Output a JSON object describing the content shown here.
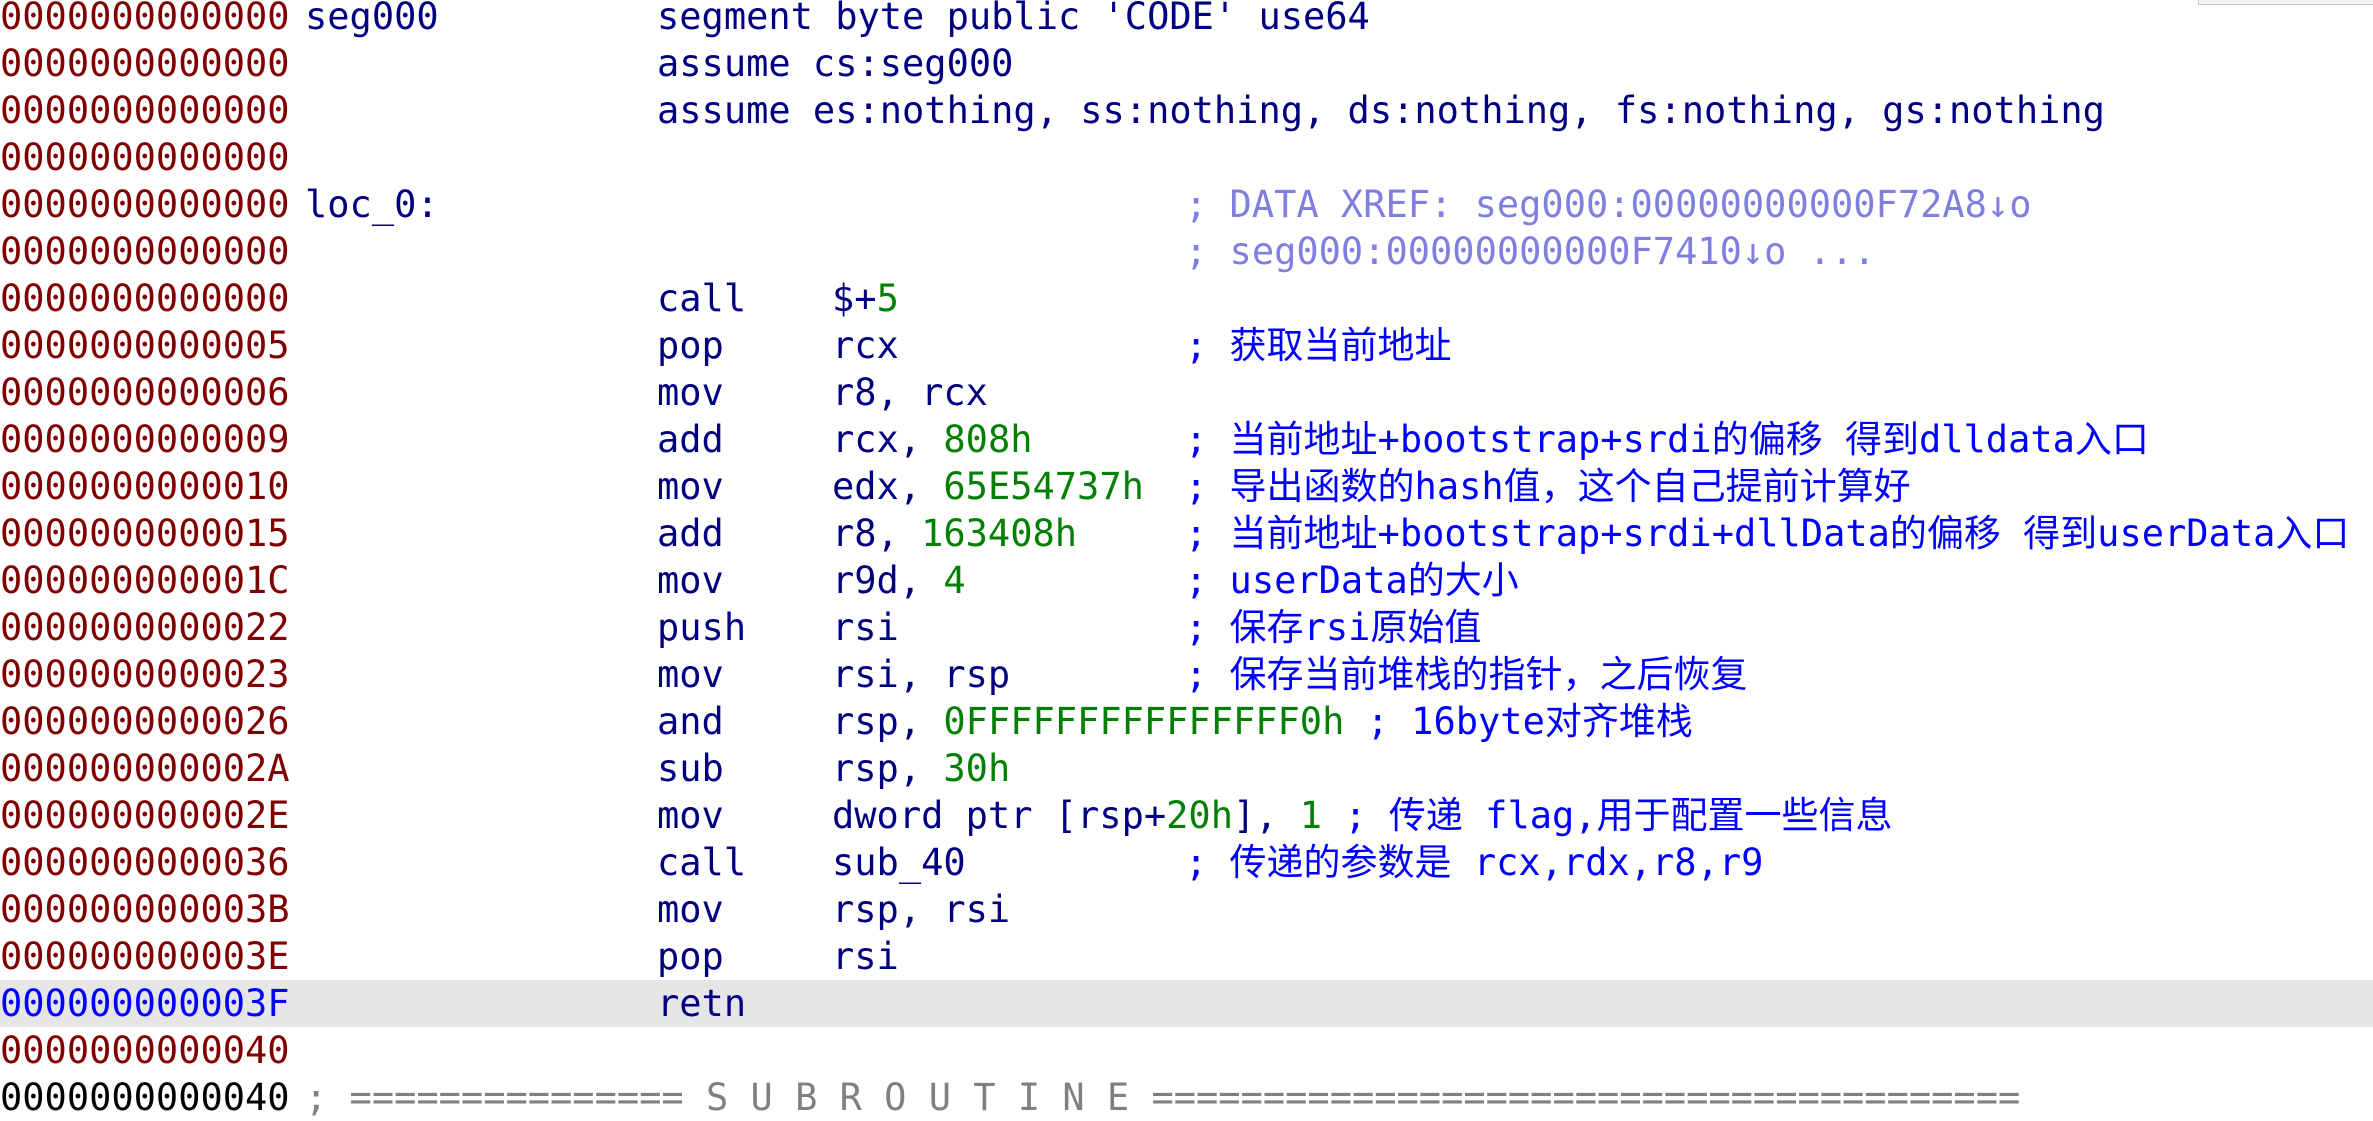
{
  "lines": [
    {
      "addr": "0000000000000",
      "label": "seg000",
      "mnem": "segment byte public 'CODE' use64"
    },
    {
      "addr": "0000000000000",
      "mnem": "assume cs:seg000"
    },
    {
      "addr": "0000000000000",
      "mnem": "assume es:nothing, ss:nothing, ds:nothing, fs:nothing, gs:nothing"
    },
    {
      "addr": "0000000000000"
    },
    {
      "addr": "0000000000000",
      "label": "loc_0:",
      "xref": "; DATA XREF: seg000:00000000000F72A8↓o"
    },
    {
      "addr": "0000000000000",
      "xref": "; seg000:00000000000F7410↓o ..."
    },
    {
      "addr": "0000000000000",
      "mnem": "call",
      "op": "$+",
      "op_num": "5"
    },
    {
      "addr": "0000000000005",
      "mnem": "pop",
      "op": "rcx",
      "comment": "; 获取当前地址"
    },
    {
      "addr": "0000000000006",
      "mnem": "mov",
      "op": "r8, rcx"
    },
    {
      "addr": "0000000000009",
      "mnem": "add",
      "op": "rcx, ",
      "op_num": "808h",
      "comment": "; 当前地址+bootstrap+srdi的偏移 得到dlldata入口"
    },
    {
      "addr": "0000000000010",
      "mnem": "mov",
      "op": "edx, ",
      "op_num": "65E54737h",
      "comment": "; 导出函数的hash值，这个自己提前计算好"
    },
    {
      "addr": "0000000000015",
      "mnem": "add",
      "op": "r8, ",
      "op_num": "163408h",
      "comment": "; 当前地址+bootstrap+srdi+dllData的偏移 得到userData入口"
    },
    {
      "addr": "000000000001C",
      "mnem": "mov",
      "op": "r9d, ",
      "op_num": "4",
      "comment": "; userData的大小"
    },
    {
      "addr": "0000000000022",
      "mnem": "push",
      "op": "rsi",
      "comment": "; 保存rsi原始值"
    },
    {
      "addr": "0000000000023",
      "mnem": "mov",
      "op": "rsi, rsp",
      "comment": "; 保存当前堆栈的指针，之后恢复"
    },
    {
      "addr": "0000000000026",
      "mnem": "and",
      "op": "rsp, ",
      "op_num": "0FFFFFFFFFFFFFFF0h",
      "inline_comment": " ; 16byte对齐堆栈"
    },
    {
      "addr": "000000000002A",
      "mnem": "sub",
      "op": "rsp, ",
      "op_num": "30h"
    },
    {
      "addr": "000000000002E",
      "mnem": "mov",
      "op": "dword ptr [rsp+",
      "op_num": "20h",
      "op_tail": "], ",
      "op_num2": "1",
      "inline_comment": " ; 传递 flag,用于配置一些信息"
    },
    {
      "addr": "0000000000036",
      "mnem": "call",
      "op": "sub_40",
      "comment": "; 传递的参数是 rcx,rdx,r8,r9"
    },
    {
      "addr": "000000000003B",
      "mnem": "mov",
      "op": "rsp, rsi"
    },
    {
      "addr": "000000000003E",
      "mnem": "pop",
      "op": "rsi"
    },
    {
      "addr": "000000000003F",
      "mnem": "retn",
      "current": true
    },
    {
      "addr": "0000000000040"
    },
    {
      "addr": "0000000000040",
      "separator": "; =============== S U B R O U T I N E ======================================="
    }
  ]
}
